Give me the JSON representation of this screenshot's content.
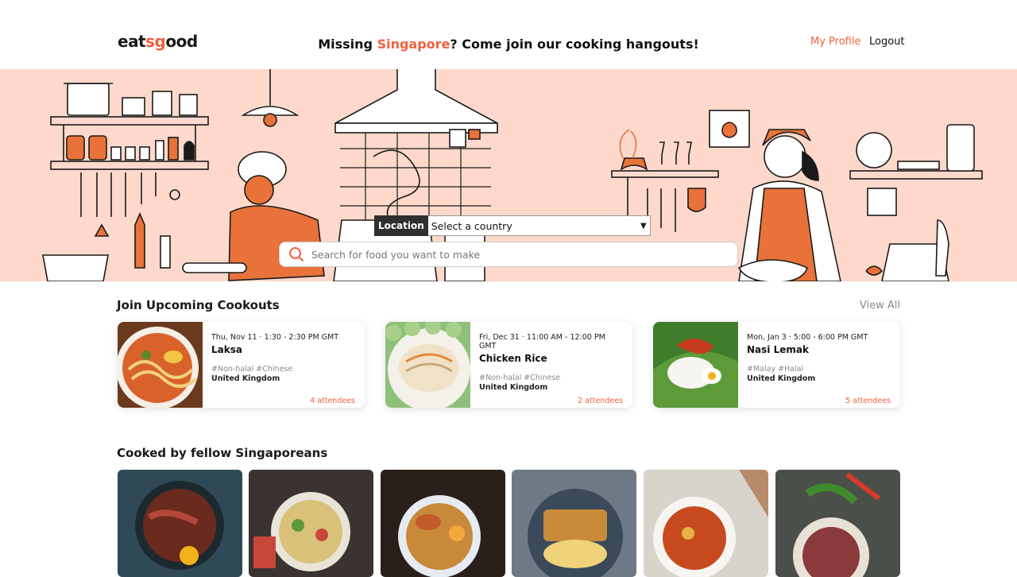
{
  "header": {
    "logo_prefix": "eat",
    "logo_accent": "sg",
    "logo_suffix": "ood",
    "tagline_pre": "Missing ",
    "tagline_highlight": "Singapore",
    "tagline_post": "? Come join our cooking hangouts!",
    "nav_profile": "My Profile",
    "nav_logout": "Logout"
  },
  "hero": {
    "location_label": "Location",
    "location_selected": "Select a country",
    "search_placeholder": "Search for food you want to make"
  },
  "cookouts": {
    "title": "Join Upcoming Cookouts",
    "view_all": "View All",
    "items": [
      {
        "date": "Thu, Nov 11 · 1:30 - 2:30 PM GMT",
        "name": "Laksa",
        "tags": "#Non-halal #Chinese",
        "country": "United Kingdom",
        "attendees": "4 attendees"
      },
      {
        "date": "Fri, Dec 31 · 11:00 AM - 12:00 PM GMT",
        "name": "Chicken Rice",
        "tags": "#Non-halal #Chinese",
        "country": "United Kingdom",
        "attendees": "2 attendees"
      },
      {
        "date": "Mon, Jan 3 · 5:00 - 6:00 PM GMT",
        "name": "Nasi Lemak",
        "tags": "#Malay #Halal",
        "country": "United Kingdom",
        "attendees": "5 attendees"
      }
    ]
  },
  "fellow": {
    "title": "Cooked by fellow Singaporeans"
  },
  "colors": {
    "accent": "#f0613d",
    "hero_bg": "#fed9cb",
    "illustration_orange": "#e8723a"
  }
}
